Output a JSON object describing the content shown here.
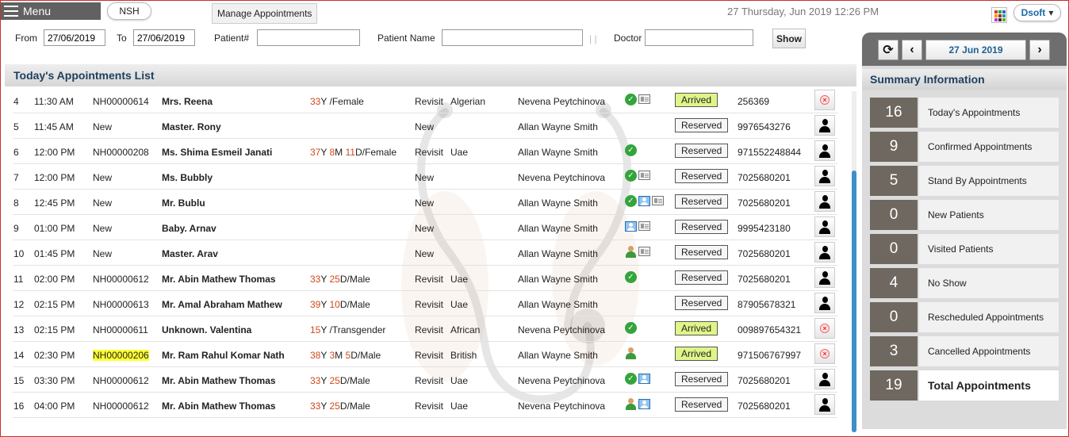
{
  "topbar": {
    "menu_label": "Menu",
    "branch": "NSH",
    "manage_label": "Manage Appointments",
    "datetime": "27 Thursday, Jun 2019  12:26 PM",
    "user": "Dsoft",
    "user_chevron": "▾"
  },
  "filters": {
    "from_label": "From",
    "from_value": "27/06/2019",
    "to_label": "To",
    "to_value": "27/06/2019",
    "patient_no_label": "Patient#",
    "patient_no_value": "",
    "patient_name_label": "Patient Name",
    "patient_name_value": "",
    "doctor_label": "Doctor",
    "doctor_value": "",
    "separator": "| |",
    "show_label": "Show"
  },
  "list": {
    "title": "Today's Appointments List",
    "rows": [
      {
        "no": "4",
        "time": "11:30 AM",
        "reg": "NH00000614",
        "name": "Mrs. Reena",
        "age": [
          [
            "33",
            "Y "
          ],
          [
            "",
            "/Female"
          ]
        ],
        "type": "Revisit",
        "nat": "Algerian",
        "doctor": "Nevena Peytchinova",
        "icons": [
          "check",
          "card"
        ],
        "status": "Arrived",
        "phone": "256369",
        "action": "cancel"
      },
      {
        "no": "5",
        "time": "11:45 AM",
        "reg": "New",
        "name": "Master. Rony",
        "age": [],
        "type": "New",
        "nat": "",
        "doctor": "Allan Wayne Smith",
        "icons": [],
        "status": "Reserved",
        "phone": "9976543276",
        "action": "person"
      },
      {
        "no": "6",
        "time": "12:00 PM",
        "reg": "NH00000208",
        "name": "Ms. Shima Esmeil Janati",
        "age": [
          [
            "37",
            "Y "
          ],
          [
            "8",
            "M "
          ],
          [
            "11",
            "D/Female"
          ]
        ],
        "type": "Revisit",
        "nat": "Uae",
        "doctor": "Allan Wayne Smith",
        "icons": [
          "check"
        ],
        "status": "Reserved",
        "phone": "971552248844",
        "action": "person"
      },
      {
        "no": "7",
        "time": "12:00 PM",
        "reg": "New",
        "name": "Ms. Bubbly",
        "age": [],
        "type": "New",
        "nat": "",
        "doctor": "Nevena Peytchinova",
        "icons": [
          "check",
          "card"
        ],
        "status": "Reserved",
        "phone": "7025680201",
        "action": "person"
      },
      {
        "no": "8",
        "time": "12:45 PM",
        "reg": "New",
        "name": "Mr. Bublu",
        "age": [],
        "type": "New",
        "nat": "",
        "doctor": "Allan Wayne Smith",
        "icons": [
          "check",
          "id",
          "card"
        ],
        "status": "Reserved",
        "phone": "7025680201",
        "action": "person"
      },
      {
        "no": "9",
        "time": "01:00 PM",
        "reg": "New",
        "name": "Baby. Arnav",
        "age": [],
        "type": "New",
        "nat": "",
        "doctor": "Allan Wayne Smith",
        "icons": [
          "id",
          "card"
        ],
        "status": "Reserved",
        "phone": "9995423180",
        "action": "person"
      },
      {
        "no": "10",
        "time": "01:45 PM",
        "reg": "New",
        "name": "Master. Arav",
        "age": [],
        "type": "New",
        "nat": "",
        "doctor": "Allan Wayne Smith",
        "icons": [
          "doc",
          "card"
        ],
        "status": "Reserved",
        "phone": "7025680201",
        "action": "person"
      },
      {
        "no": "11",
        "time": "02:00 PM",
        "reg": "NH00000612",
        "name": "Mr. Abin Mathew Thomas",
        "age": [
          [
            "33",
            "Y "
          ],
          [
            "25",
            "D/Male"
          ]
        ],
        "type": "Revisit",
        "nat": "Uae",
        "doctor": "Allan Wayne Smith",
        "icons": [
          "check"
        ],
        "status": "Reserved",
        "phone": "7025680201",
        "action": "person"
      },
      {
        "no": "12",
        "time": "02:15 PM",
        "reg": "NH00000613",
        "name": "Mr. Amal Abraham Mathew",
        "age": [
          [
            "39",
            "Y "
          ],
          [
            "10",
            "D/Male"
          ]
        ],
        "type": "Revisit",
        "nat": "Uae",
        "doctor": "Allan Wayne Smith",
        "icons": [],
        "status": "Reserved",
        "phone": "87905678321",
        "action": "person"
      },
      {
        "no": "13",
        "time": "02:15 PM",
        "reg": "NH00000611",
        "name": "Unknown. Valentina",
        "age": [
          [
            "15",
            "Y "
          ],
          [
            "",
            "/Transgender"
          ]
        ],
        "type": "Revisit",
        "nat": "African",
        "doctor": "Nevena Peytchinova",
        "icons": [
          "check"
        ],
        "status": "Arrived",
        "phone": "009897654321",
        "action": "cancel"
      },
      {
        "no": "14",
        "time": "02:30 PM",
        "reg": "NH00000206",
        "reg_highlight": true,
        "name": "Mr. Ram Rahul Komar Nath",
        "age": [
          [
            "38",
            "Y "
          ],
          [
            "3",
            "M "
          ],
          [
            "5",
            "D/Male"
          ]
        ],
        "type": "Revisit",
        "nat": "British",
        "doctor": "Allan Wayne Smith",
        "icons": [
          "doc"
        ],
        "status": "Arrived",
        "phone": "971506767997",
        "action": "cancel"
      },
      {
        "no": "15",
        "time": "03:30 PM",
        "reg": "NH00000612",
        "name": "Mr. Abin Mathew Thomas",
        "age": [
          [
            "33",
            "Y "
          ],
          [
            "25",
            "D/Male"
          ]
        ],
        "type": "Revisit",
        "nat": "Uae",
        "doctor": "Nevena Peytchinova",
        "icons": [
          "check",
          "id"
        ],
        "status": "Reserved",
        "phone": "7025680201",
        "action": "person"
      },
      {
        "no": "16",
        "time": "04:00 PM",
        "reg": "NH00000612",
        "name": "Mr. Abin Mathew Thomas",
        "age": [
          [
            "33",
            "Y "
          ],
          [
            "25",
            "D/Male"
          ]
        ],
        "type": "Revisit",
        "nat": "Uae",
        "doctor": "Nevena Peytchinova",
        "icons": [
          "doc",
          "id"
        ],
        "status": "Reserved",
        "phone": "7025680201",
        "action": "person"
      }
    ]
  },
  "summary": {
    "date": "27 Jun 2019",
    "title": "Summary Information",
    "items": [
      {
        "count": "16",
        "label": "Today's Appointments"
      },
      {
        "count": "9",
        "label": "Confirmed Appointments"
      },
      {
        "count": "5",
        "label": "Stand By Appointments"
      },
      {
        "count": "0",
        "label": "New Patients"
      },
      {
        "count": "0",
        "label": "Visited Patients"
      },
      {
        "count": "4",
        "label": "No Show"
      },
      {
        "count": "0",
        "label": "Rescheduled Appointments"
      },
      {
        "count": "3",
        "label": "Cancelled Appointments"
      },
      {
        "count": "19",
        "label": "Total Appointments",
        "total": true
      }
    ]
  },
  "colors": {
    "accent_blue": "#1d3f5e",
    "age_number": "#d04a1c",
    "arrived_bg": "#dff58a",
    "highlight": "#ffff33",
    "summary_count_bg": "#6e6860"
  }
}
